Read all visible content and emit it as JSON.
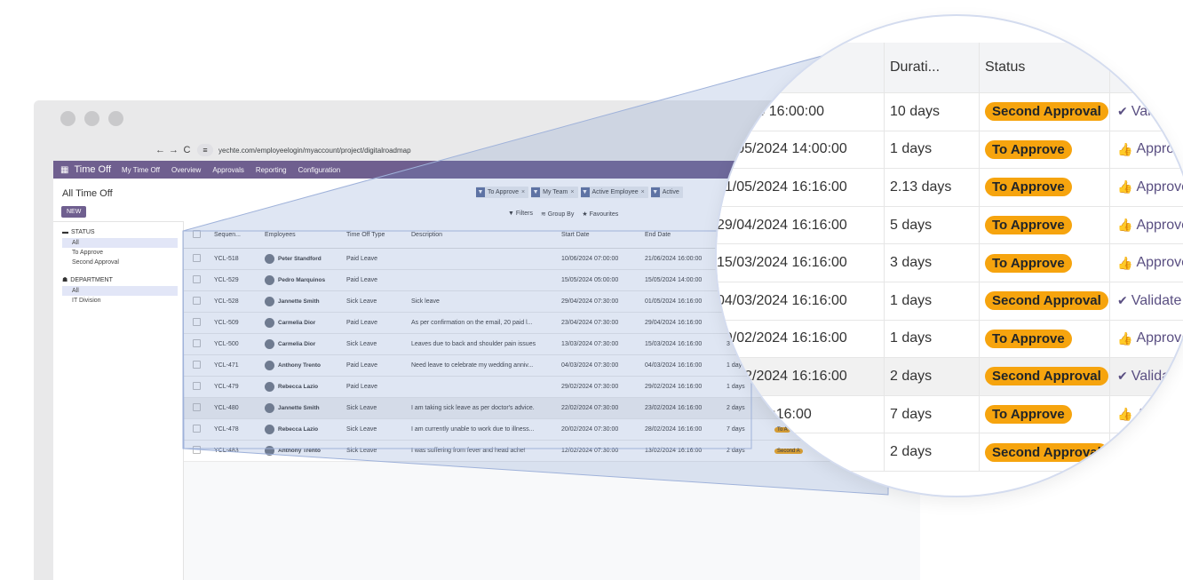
{
  "browser": {
    "url": "yechte.com/employeelogin/myaccount/project/digitalroadmap"
  },
  "topbar": {
    "brand": "Time Off",
    "menu": [
      "My Time Off",
      "Overview",
      "Approvals",
      "Reporting",
      "Configuration"
    ]
  },
  "control": {
    "title": "All Time Off",
    "new_label": "NEW",
    "facets": [
      "To Approve",
      "My Team",
      "Active Employee",
      "Active"
    ],
    "filters_label": "Filters",
    "groupby_label": "Group By",
    "favourites_label": "Favourites"
  },
  "sidebar": {
    "status_heading": "STATUS",
    "status_items": [
      "All",
      "To Approve",
      "Second Approval"
    ],
    "department_heading": "DEPARTMENT",
    "department_items": [
      "All",
      "IT Division"
    ]
  },
  "table": {
    "headers": [
      "Sequen...",
      "Employees",
      "Time Off Type",
      "Description",
      "Start Date",
      "End Date"
    ],
    "rows": [
      {
        "seq": "YCL-518",
        "emp": "Peter Standford",
        "type": "Paid Leave",
        "desc": "",
        "start": "10/06/2024 07:00:00",
        "end": "21/06/2024 16:00:00",
        "dur": "",
        "status": ""
      },
      {
        "seq": "YCL-529",
        "emp": "Pedro Marquinos",
        "type": "Paid Leave",
        "desc": "",
        "start": "15/05/2024 05:00:00",
        "end": "15/05/2024 14:00:00",
        "dur": "",
        "status": ""
      },
      {
        "seq": "YCL-528",
        "emp": "Jannette Smith",
        "type": "Sick Leave",
        "desc": "Sick leave",
        "start": "29/04/2024 07:30:00",
        "end": "01/05/2024 16:16:00",
        "dur": "2",
        "status": ""
      },
      {
        "seq": "YCL-509",
        "emp": "Carmelia Dior",
        "type": "Paid Leave",
        "desc": "As per confirmation on the email, 20 paid l...",
        "start": "23/04/2024 07:30:00",
        "end": "29/04/2024 16:16:00",
        "dur": "5 d",
        "status": ""
      },
      {
        "seq": "YCL-500",
        "emp": "Carmelia Dior",
        "type": "Sick Leave",
        "desc": "Leaves due to back and shoulder pain issues",
        "start": "13/03/2024 07:30:00",
        "end": "15/03/2024 16:16:00",
        "dur": "3 da",
        "status": ""
      },
      {
        "seq": "YCL-471",
        "emp": "Anthony Trento",
        "type": "Paid Leave",
        "desc": "Need leave to celebrate my wedding anniv...",
        "start": "04/03/2024 07:30:00",
        "end": "04/03/2024 16:16:00",
        "dur": "1 days",
        "status": ""
      },
      {
        "seq": "YCL-479",
        "emp": "Rebecca Lazio",
        "type": "Paid Leave",
        "desc": "",
        "start": "29/02/2024 07:30:00",
        "end": "29/02/2024 16:16:00",
        "dur": "1 days",
        "status": ""
      },
      {
        "seq": "YCL-480",
        "emp": "Jannette Smith",
        "type": "Sick Leave",
        "desc": "I am taking sick leave as per doctor's advice.",
        "start": "22/02/2024 07:30:00",
        "end": "23/02/2024 16:16:00",
        "dur": "2 days",
        "status": ""
      },
      {
        "seq": "YCL-478",
        "emp": "Rebecca Lazio",
        "type": "Sick Leave",
        "desc": "I am currently unable to work due to illness...",
        "start": "20/02/2024 07:30:00",
        "end": "28/02/2024 16:16:00",
        "dur": "7 days",
        "status": "To A"
      },
      {
        "seq": "YCL-483",
        "emp": "Anthony Trento",
        "type": "Sick Leave",
        "desc": "I was suffering from fever and head ache!",
        "start": "12/02/2024 07:30:00",
        "end": "13/02/2024 16:16:00",
        "dur": "2 days",
        "status": "Second A"
      }
    ]
  },
  "lens": {
    "headers": [
      "Durati...",
      "Status"
    ],
    "rows": [
      {
        "end": ")6/2024 16:00:00",
        "dur": "10 days",
        "status": "Second Approval",
        "action": "Vali",
        "action_icon": "check-icon"
      },
      {
        "end": "15/05/2024 14:00:00",
        "dur": "1 days",
        "status": "To Approve",
        "action": "Approv",
        "action_icon": "thumbs-up-icon"
      },
      {
        "end": "01/05/2024 16:16:00",
        "dur": "2.13 days",
        "status": "To Approve",
        "action": "Approve",
        "action_icon": "thumbs-up-icon"
      },
      {
        "end": "29/04/2024 16:16:00",
        "dur": "5 days",
        "status": "To Approve",
        "action": "Approve",
        "action_icon": "thumbs-up-icon"
      },
      {
        "end": "15/03/2024 16:16:00",
        "dur": "3 days",
        "status": "To Approve",
        "action": "Approve",
        "action_icon": "thumbs-up-icon"
      },
      {
        "end": "04/03/2024 16:16:00",
        "dur": "1 days",
        "status": "Second Approval",
        "action": "Validate",
        "action_icon": "check-icon"
      },
      {
        "end": "29/02/2024 16:16:00",
        "dur": "1 days",
        "status": "To Approve",
        "action": "Approve",
        "action_icon": "thumbs-up-icon"
      },
      {
        "end": "23/02/2024 16:16:00",
        "dur": "2 days",
        "status": "Second Approval",
        "action": "Validat",
        "action_icon": "check-icon"
      },
      {
        "end": "/2024 16:16:00",
        "dur": "7 days",
        "status": "To Approve",
        "action": "Ap",
        "action_icon": "thumbs-up-icon"
      },
      {
        "end": "16:16:00",
        "dur": "2 days",
        "status": "Second Approval",
        "action": "",
        "action_icon": ""
      }
    ]
  }
}
